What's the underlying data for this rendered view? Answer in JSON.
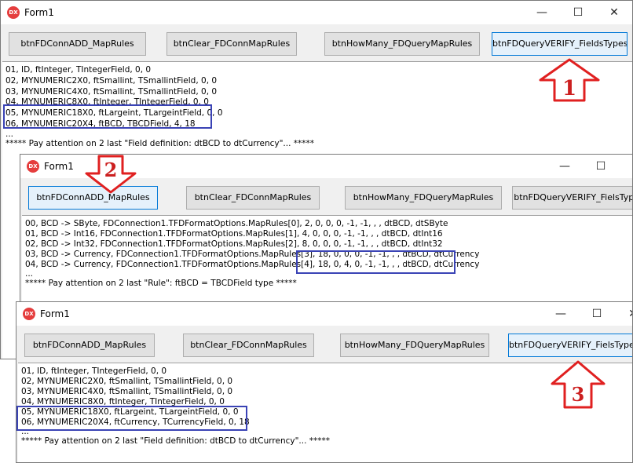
{
  "win1": {
    "title": "Form1",
    "buttons": [
      "btnFDConnADD_MapRules",
      "btnClear_FDConnMapRules",
      "btnHowMany_FDQueryMapRules",
      "btnFDQueryVERIFY_FieldsTypes"
    ],
    "lines": [
      "01, ID, ftInteger, TIntegerField, 0, 0",
      "02, MYNUMERIC2X0, ftSmallint, TSmallintField, 0, 0",
      "03, MYNUMERIC4X0, ftSmallint, TSmallintField, 0, 0",
      "04, MYNUMERIC8X0, ftInteger, TIntegerField, 0, 0",
      "05, MYNUMERIC18X0, ftLargeint, TLargeintField, 0, 0",
      "06, MYNUMERIC20X4, ftBCD, TBCDField, 4, 18",
      "...",
      "***** Pay attention on 2 last \"Field definition: dtBCD to dtCurrency\"... *****"
    ],
    "badge": "1"
  },
  "win2": {
    "title": "Form1",
    "buttons": [
      "btnFDConnADD_MapRules",
      "btnClear_FDConnMapRules",
      "btnHowMany_FDQueryMapRules",
      "btnFDQueryVERIFY_FielsTypes"
    ],
    "lines": [
      "00, BCD -> SByte, FDConnection1.TFDFormatOptions.MapRules[0], 2, 0, 0, 0, -1, -1, , , dtBCD, dtSByte",
      "01, BCD -> Int16, FDConnection1.TFDFormatOptions.MapRules[1], 4, 0, 0, 0, -1, -1, , , dtBCD, dtInt16",
      "02, BCD -> Int32, FDConnection1.TFDFormatOptions.MapRules[2], 8, 0, 0, 0, -1, -1, , , dtBCD, dtInt32",
      "03, BCD -> Currency, FDConnection1.TFDFormatOptions.MapRules[3], 18, 0, 0, 0, -1, -1, , , dtBCD, dtCurrency",
      "04, BCD -> Currency, FDConnection1.TFDFormatOptions.MapRules[4], 18, 0, 4, 0, -1, -1, , , dtBCD, dtCurrency",
      "...",
      "***** Pay attention on 2 last \"Rule\": ftBCD = TBCDField type *****"
    ],
    "badge": "2"
  },
  "win3": {
    "title": "Form1",
    "buttons": [
      "btnFDConnADD_MapRules",
      "btnClear_FDConnMapRules",
      "btnHowMany_FDQueryMapRules",
      "btnFDQueryVERIFY_FielsTypes"
    ],
    "lines": [
      "01, ID, ftInteger, TIntegerField, 0, 0",
      "02, MYNUMERIC2X0, ftSmallint, TSmallintField, 0, 0",
      "03, MYNUMERIC4X0, ftSmallint, TSmallintField, 0, 0",
      "04, MYNUMERIC8X0, ftInteger, TIntegerField, 0, 0",
      "05, MYNUMERIC18X0, ftLargeint, TLargeintField, 0, 0",
      "06, MYNUMERIC20X4, ftCurrency, TCurrencyField, 0, 18",
      "...",
      "***** Pay attention on 2 last \"Field definition: dtBCD to dtCurrency\"... *****"
    ],
    "badge": "3"
  },
  "app_icon_label": "DX",
  "window_controls": [
    "minimize-icon",
    "maximize-icon",
    "close-icon"
  ],
  "colors": {
    "highlight": "#3a43b5",
    "arrow_fill": "#ffffff",
    "arrow_stroke": "#e02020",
    "focused_button": "#e5f1fb"
  }
}
